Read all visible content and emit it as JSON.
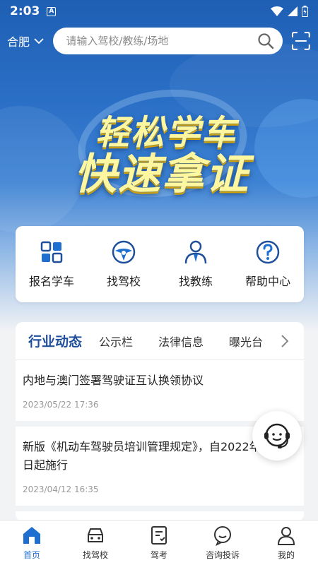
{
  "status": {
    "time": "2:03",
    "notif_glyph": "A"
  },
  "header": {
    "city": "合肥",
    "search_placeholder": "请输入驾校/教练/场地"
  },
  "banner": {
    "line1": "轻松学车",
    "line2": "快速拿证"
  },
  "menu": [
    {
      "label": "报名学车",
      "icon": "grid-icon"
    },
    {
      "label": "找驾校",
      "icon": "steering-wheel-icon"
    },
    {
      "label": "找教练",
      "icon": "coach-icon"
    },
    {
      "label": "帮助中心",
      "icon": "question-icon"
    }
  ],
  "news": {
    "tabs": [
      "行业动态",
      "公示栏",
      "法律信息",
      "曝光台"
    ],
    "items": [
      {
        "title": "内地与澳门签署驾驶证互认换领协议",
        "date": "2023/05/22 17:36"
      },
      {
        "title": "新版《机动车驾驶员培训管理规定》，自2022年10月1日起施行",
        "date": "2023/04/12 16:35"
      }
    ]
  },
  "nav": [
    {
      "label": "首页",
      "icon": "home-icon"
    },
    {
      "label": "找驾校",
      "icon": "car-icon"
    },
    {
      "label": "驾考",
      "icon": "exam-icon"
    },
    {
      "label": "咨询投诉",
      "icon": "chat-icon"
    },
    {
      "label": "我的",
      "icon": "user-icon"
    }
  ],
  "colors": {
    "accent": "#1f6fd0",
    "tab_active": "#1f4f9a",
    "banner_text": "#fff7a0"
  }
}
